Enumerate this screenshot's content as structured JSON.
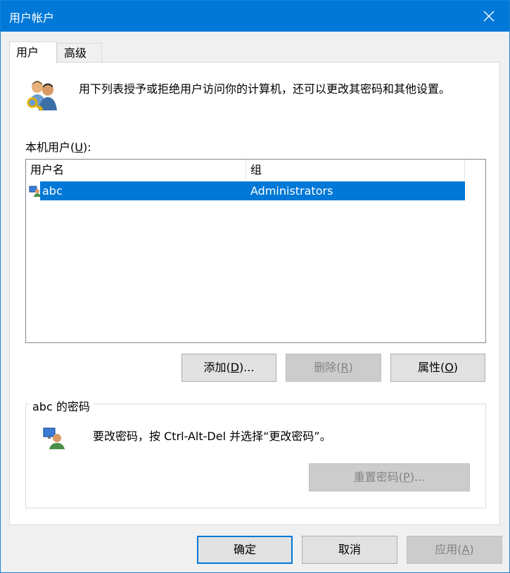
{
  "window": {
    "title": "用户帐户",
    "close_glyph": "✕"
  },
  "tabs": [
    {
      "label": "用户",
      "active": true
    },
    {
      "label": "高级",
      "active": false
    }
  ],
  "intro": {
    "text": "用下列表授予或拒绝用户访问你的计算机，还可以更改其密码和其他设置。",
    "icon": "users-key-icon"
  },
  "users_label": {
    "prefix": "本机用户(",
    "accel": "U",
    "suffix": "):"
  },
  "users_list": {
    "columns": [
      "用户名",
      "组"
    ],
    "rows": [
      {
        "username": "abc",
        "group": "Administrators",
        "selected": true,
        "icon": "user-icon"
      }
    ]
  },
  "list_buttons": {
    "add": {
      "prefix": "添加(",
      "accel": "D",
      "suffix": ")..."
    },
    "remove": {
      "prefix": "删除(",
      "accel": "R",
      "suffix": ")"
    },
    "properties": {
      "prefix": "属性(",
      "accel": "O",
      "suffix": ")"
    }
  },
  "password_group": {
    "title": "abc 的密码",
    "text": "要改密码，按 Ctrl-Alt-Del 并选择“更改密码”。",
    "icon": "user-monitor-icon",
    "reset_button": {
      "prefix": "重置密码(",
      "accel": "P",
      "suffix": ")..."
    }
  },
  "footer": {
    "ok": "确定",
    "cancel": "取消",
    "apply": {
      "prefix": "应用(",
      "accel": "A",
      "suffix": ")"
    }
  },
  "colors": {
    "accent": "#0078d7",
    "selection": "#0078d7",
    "disabled_bg": "#cccccc",
    "disabled_text": "#838383"
  }
}
